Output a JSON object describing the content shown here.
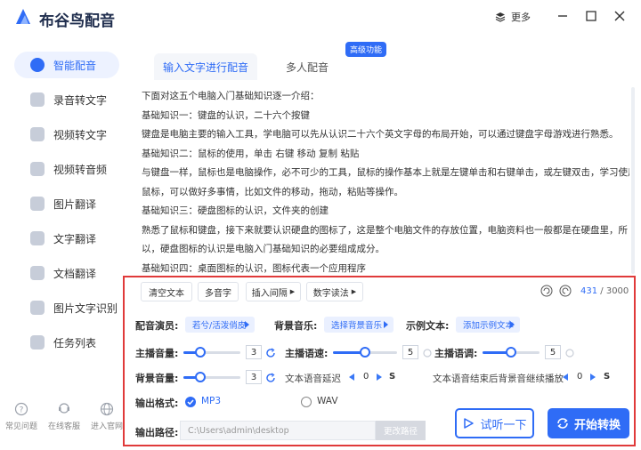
{
  "app": {
    "title": "布谷鸟配音",
    "more_label": "更多"
  },
  "colors": {
    "accent": "#2f6cf6",
    "highlight_border": "#e03a3a"
  },
  "sidebar": {
    "items": [
      {
        "label": "智能配音",
        "icon": "mic-icon",
        "active": true
      },
      {
        "label": "录音转文字",
        "icon": "record-icon",
        "active": false
      },
      {
        "label": "视频转文字",
        "icon": "video-text-icon",
        "active": false
      },
      {
        "label": "视频转音频",
        "icon": "video-audio-icon",
        "active": false
      },
      {
        "label": "图片翻译",
        "icon": "image-translate-icon",
        "active": false
      },
      {
        "label": "文字翻译",
        "icon": "text-translate-icon",
        "active": false
      },
      {
        "label": "文档翻译",
        "icon": "doc-translate-icon",
        "active": false
      },
      {
        "label": "图片文字识别",
        "icon": "ocr-icon",
        "active": false
      },
      {
        "label": "任务列表",
        "icon": "task-list-icon",
        "active": false
      }
    ],
    "footer": [
      {
        "label": "常见问题",
        "icon": "help-icon"
      },
      {
        "label": "在线客服",
        "icon": "service-icon"
      },
      {
        "label": "进入官网",
        "icon": "website-icon"
      }
    ]
  },
  "tabs": [
    {
      "label": "输入文字进行配音"
    },
    {
      "label": "多人配音"
    }
  ],
  "badge": "高级功能",
  "text_lines": [
    "下面对这五个电脑入门基础知识逐一介绍：",
    "基础知识一：键盘的认识，二十六个按键",
    "键盘是电脑主要的输入工具，学电脑可以先从认识二十六个英文字母的布局开始，可以通过键盘字母游戏进行熟悉。",
    "基础知识二：鼠标的使用，单击 右键 移动 复制 粘贴",
    "与键盘一样，鼠标也是电脑操作，必不可少的工具，鼠标的操作基本上就是左键单击和右键单击，或左键双击，学习使用",
    "鼠标，可以做好多事情，比如文件的移动，拖动，粘贴等操作。",
    "基础知识三：硬盘图标的认识，文件夹的创建",
    "熟悉了鼠标和键盘，接下来就要认识硬盘的图标了，这是整个电脑文件的存放位置，电脑资料也一般都是在硬盘里，所",
    "以，硬盘图标的认识是电脑入门基础知识的必要组成成分。",
    "基础知识四：桌面图标的认识，图标代表一个应用程序"
  ],
  "toolbar": {
    "clear": "清空文本",
    "polyphone": "多音字",
    "insert_pause": "插入间隔",
    "number_read": "数字读法",
    "char_count": "431",
    "char_total": "/ 3000"
  },
  "settings": {
    "voice_label": "配音演员:",
    "voice_value": "若兮/活泼俏皮",
    "bgm_label": "背景音乐:",
    "bgm_value": "选择背景音乐",
    "sample_label": "示例文本:",
    "sample_value": "添加示例文本",
    "main_volume_label": "主播音量:",
    "main_volume_value": "3",
    "main_volume_level": 0.3,
    "speed_label": "主播语速:",
    "speed_value": "5",
    "speed_level": 0.5,
    "pitch_label": "主播语调:",
    "pitch_value": "5",
    "pitch_level": 0.5,
    "bg_volume_label": "背景音量:",
    "bg_volume_value": "3",
    "bg_volume_level": 0.3,
    "delay_label": "文本语音延迟",
    "delay_value": "0",
    "delay_unit": "S",
    "continue_label": "文本语音结束后背景音继续播放",
    "continue_value": "0",
    "continue_unit": "S",
    "format_label": "输出格式:",
    "format_mp3": "MP3",
    "format_wav": "WAV",
    "path_label": "输出路径:",
    "path_value": "C:\\Users\\admin\\desktop",
    "path_button": "更改路径",
    "listen_button": "试听一下",
    "convert_button": "开始转换"
  }
}
